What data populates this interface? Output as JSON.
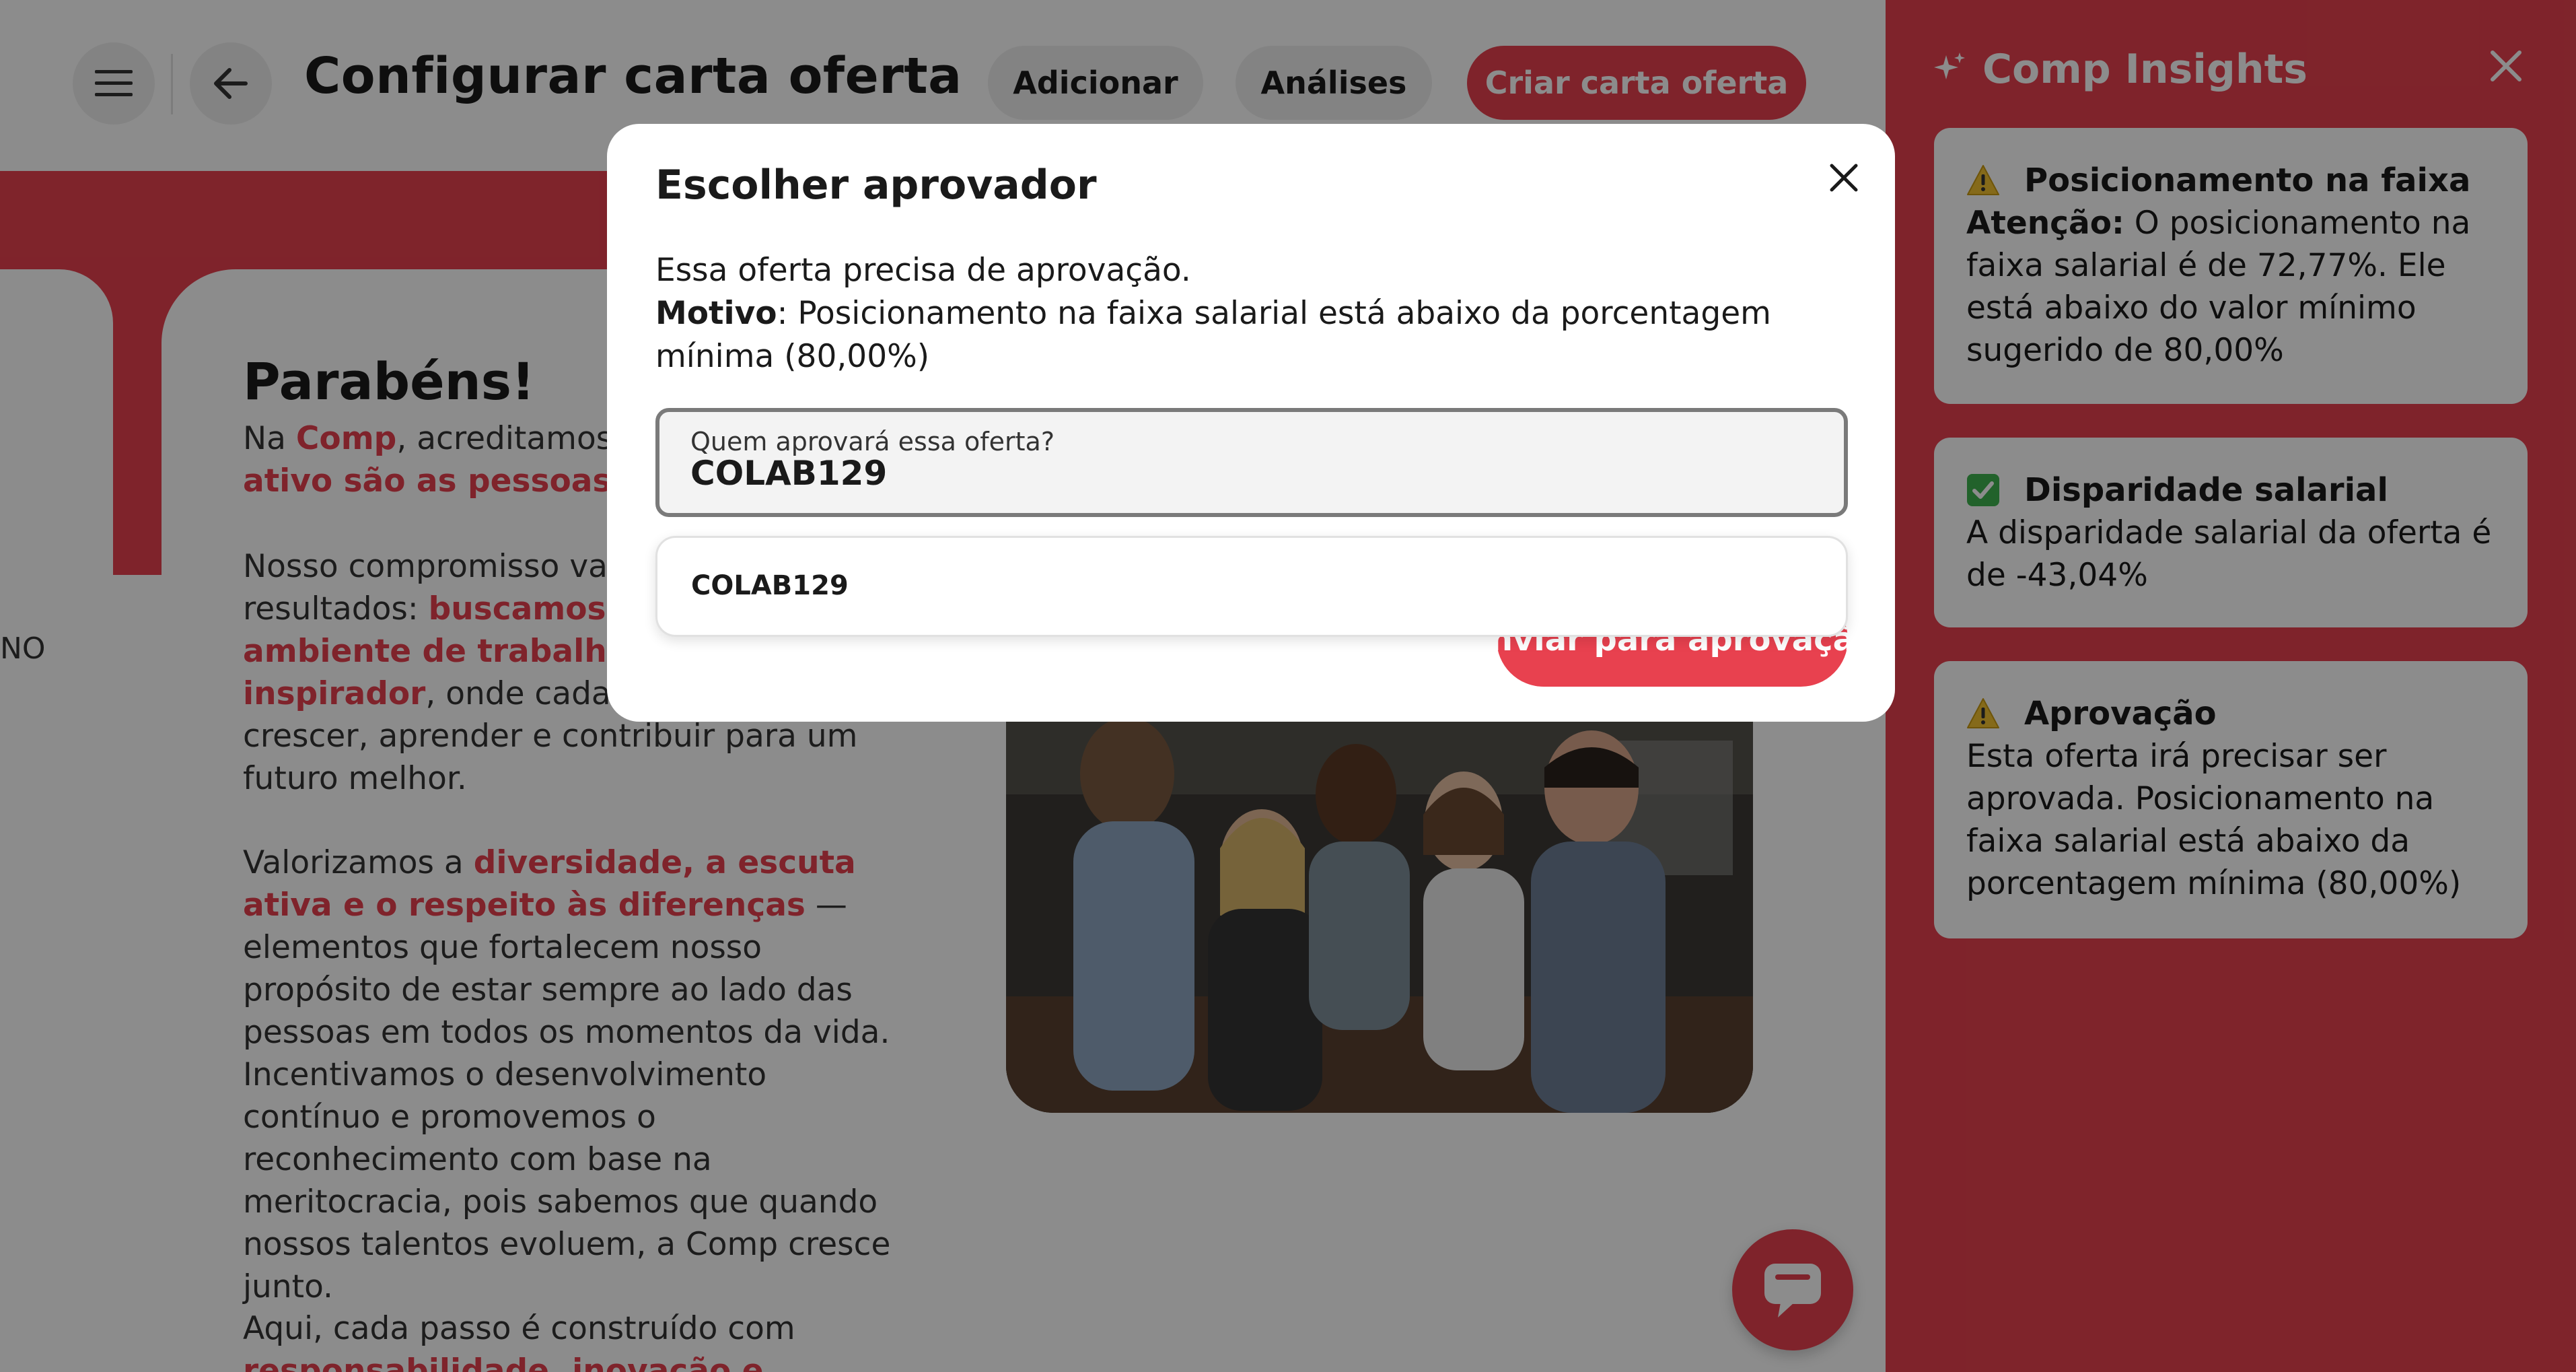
{
  "header": {
    "title": "Configurar carta oferta",
    "buttons": {
      "add": "Adicionar",
      "analyses": "Análises",
      "create": "Criar carta oferta"
    }
  },
  "left_card": {
    "text": "NO"
  },
  "content": {
    "heading": "Parabéns!",
    "p1": {
      "a": "Na ",
      "b": "Comp",
      "c": ", acreditamos q",
      "d": "ativo são as pessoas",
      "e": "."
    },
    "p2": {
      "a": "Nosso compromisso vai",
      "b": "resultados: ",
      "c": "buscamos c",
      "d": "ambiente de trabalho i",
      "e": "inspirador",
      "f": ", onde cada c",
      "g": "crescer, aprender e contribuir para um futuro melhor."
    },
    "p3": {
      "a": "Valorizamos a ",
      "b": "diversidade, a escuta ativa e o respeito às diferenças",
      "c": " — elementos que fortalecem nosso propósito de estar sempre ao lado das pessoas em todos os momentos da vida. Incentivamos o desenvolvimento contínuo e promovemos o reconhecimento com base na meritocracia, pois sabemos que quando nossos talentos evoluem, a Comp cresce junto."
    },
    "p4": {
      "a": "Aqui, cada passo é construído com",
      "b": "responsabilidade, inovação e cuidado"
    }
  },
  "insights": {
    "title": "Comp Insights",
    "cards": [
      {
        "title": "Posicionamento na faixa",
        "icon": "warning-icon",
        "strong": "Atenção:",
        "body": " O posicionamento na faixa salarial é de 72,77%. Ele está abaixo do valor mínimo sugerido de 80,00%"
      },
      {
        "title": "Disparidade salarial",
        "icon": "check-icon",
        "body": "A disparidade salarial da oferta é de -43,04%"
      },
      {
        "title": "Aprovação",
        "icon": "warning-icon",
        "body": "Esta oferta irá precisar ser aprovada. Posicionamento na faixa salarial está abaixo da porcentagem mínima (80,00%)"
      }
    ]
  },
  "modal": {
    "title": "Escolher aprovador",
    "line1": "Essa oferta precisa de aprovação.",
    "reason_label": "Motivo",
    "reason_text": ": Posicionamento na faixa salarial está abaixo da porcentagem mínima (80,00%)",
    "field_label": "Quem aprovará essa oferta?",
    "field_value": "COLAB129",
    "option": "COLAB129",
    "send_button": "Enviar para aprovação"
  },
  "colors": {
    "accent": "#e8414f",
    "overlay": "rgba(0,0,0,0.45)"
  }
}
